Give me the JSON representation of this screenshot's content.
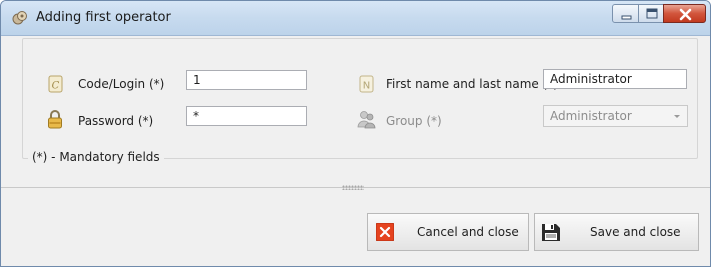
{
  "window": {
    "title": "Adding first operator",
    "icon": "operator-app-icon"
  },
  "title_buttons": {
    "minimize_icon": "minimize-icon",
    "maximize_icon": "maximize-icon",
    "close_icon": "close-icon",
    "close_color": "#c8442a"
  },
  "form": {
    "code_login": {
      "label": "Code/Login (*)",
      "value": "1",
      "icon": "code-login-icon"
    },
    "password": {
      "label": "Password (*)",
      "value": "*",
      "icon": "padlock-icon"
    },
    "first_last_name": {
      "label": "First name and last name (*)",
      "value": "Administrator",
      "icon": "name-card-icon"
    },
    "group": {
      "label": "Group (*)",
      "value": "Administrator",
      "icon": "users-group-icon",
      "disabled": true
    },
    "mandatory_note": "(*) - Mandatory fields"
  },
  "buttons": {
    "cancel_label": "Cancel and close",
    "cancel_icon": "cancel-x-icon",
    "cancel_color": "#e5431f",
    "save_label": "Save and close",
    "save_icon": "floppy-disk-icon"
  }
}
